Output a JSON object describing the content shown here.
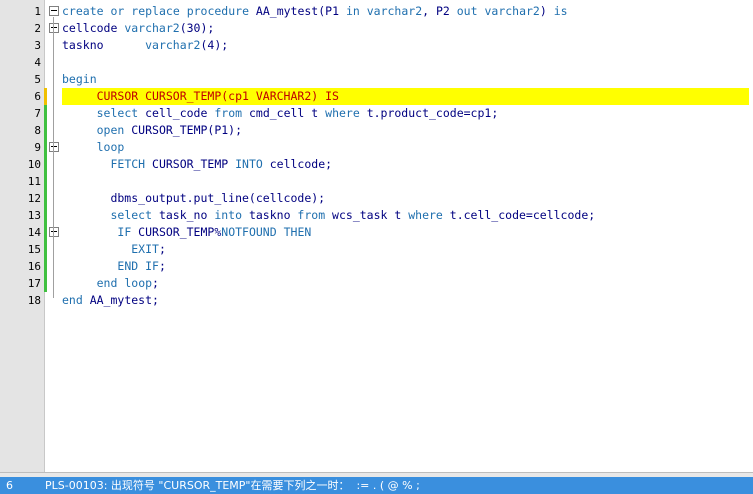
{
  "editor": {
    "lines": [
      {
        "n": "1",
        "tokens": [
          [
            "kw",
            "create"
          ],
          [
            "txt",
            " "
          ],
          [
            "kw",
            "or"
          ],
          [
            "txt",
            " "
          ],
          [
            "kw",
            "replace"
          ],
          [
            "txt",
            " "
          ],
          [
            "kw",
            "procedure"
          ],
          [
            "txt",
            " AA_mytest(P1 "
          ],
          [
            "kw",
            "in"
          ],
          [
            "txt",
            " "
          ],
          [
            "kw",
            "varchar2"
          ],
          [
            "txt",
            ", P2 "
          ],
          [
            "kw",
            "out"
          ],
          [
            "txt",
            " "
          ],
          [
            "kw",
            "varchar2"
          ],
          [
            "txt",
            ") "
          ],
          [
            "kw",
            "is"
          ]
        ]
      },
      {
        "n": "2",
        "tokens": [
          [
            "txt",
            "cellcode "
          ],
          [
            "kw",
            "varchar2"
          ],
          [
            "txt",
            "(30);"
          ]
        ]
      },
      {
        "n": "3",
        "tokens": [
          [
            "txt",
            "taskno      "
          ],
          [
            "kw",
            "varchar2"
          ],
          [
            "txt",
            "(4);"
          ]
        ]
      },
      {
        "n": "4",
        "tokens": []
      },
      {
        "n": "5",
        "tokens": [
          [
            "kw",
            "begin"
          ]
        ]
      },
      {
        "n": "6",
        "tokens": [
          [
            "txt",
            "     "
          ],
          [
            "kwr",
            "CURSOR CURSOR_TEMP(cp1 VARCHAR2) IS"
          ]
        ]
      },
      {
        "n": "7",
        "tokens": [
          [
            "txt",
            "     "
          ],
          [
            "kw",
            "select"
          ],
          [
            "txt",
            " cell_code "
          ],
          [
            "kw",
            "from"
          ],
          [
            "txt",
            " cmd_cell t "
          ],
          [
            "kw",
            "where"
          ],
          [
            "txt",
            " t.product_code=cp1;"
          ]
        ]
      },
      {
        "n": "8",
        "tokens": [
          [
            "txt",
            "     "
          ],
          [
            "kw",
            "open"
          ],
          [
            "txt",
            " CURSOR_TEMP(P1);"
          ]
        ]
      },
      {
        "n": "9",
        "tokens": [
          [
            "txt",
            "     "
          ],
          [
            "kw",
            "loop"
          ]
        ]
      },
      {
        "n": "10",
        "tokens": [
          [
            "txt",
            "       "
          ],
          [
            "kw",
            "FETCH"
          ],
          [
            "txt",
            " CURSOR_TEMP "
          ],
          [
            "kw",
            "INTO"
          ],
          [
            "txt",
            " cellcode;"
          ]
        ]
      },
      {
        "n": "11",
        "tokens": []
      },
      {
        "n": "12",
        "tokens": [
          [
            "txt",
            "       dbms_output.put_line(cellcode);"
          ]
        ]
      },
      {
        "n": "13",
        "tokens": [
          [
            "txt",
            "       "
          ],
          [
            "kw",
            "select"
          ],
          [
            "txt",
            " task_no "
          ],
          [
            "kw",
            "into"
          ],
          [
            "txt",
            " taskno "
          ],
          [
            "kw",
            "from"
          ],
          [
            "txt",
            " wcs_task t "
          ],
          [
            "kw",
            "where"
          ],
          [
            "txt",
            " t.cell_code=cellcode;"
          ]
        ]
      },
      {
        "n": "14",
        "tokens": [
          [
            "txt",
            "        "
          ],
          [
            "kw",
            "IF"
          ],
          [
            "txt",
            " CURSOR_TEMP%"
          ],
          [
            "kw",
            "NOTFOUND"
          ],
          [
            "txt",
            " "
          ],
          [
            "kw",
            "THEN"
          ]
        ]
      },
      {
        "n": "15",
        "tokens": [
          [
            "txt",
            "          "
          ],
          [
            "kw",
            "EXIT"
          ],
          [
            "txt",
            ";"
          ]
        ]
      },
      {
        "n": "16",
        "tokens": [
          [
            "txt",
            "        "
          ],
          [
            "kw",
            "END"
          ],
          [
            "txt",
            " "
          ],
          [
            "kw",
            "IF"
          ],
          [
            "txt",
            ";"
          ]
        ]
      },
      {
        "n": "17",
        "tokens": [
          [
            "txt",
            "     "
          ],
          [
            "kw",
            "end"
          ],
          [
            "txt",
            " "
          ],
          [
            "kw",
            "loop"
          ],
          [
            "txt",
            ";"
          ]
        ]
      },
      {
        "n": "18",
        "tokens": [
          [
            "kw",
            "end"
          ],
          [
            "txt",
            " AA_mytest;"
          ]
        ]
      }
    ]
  },
  "status": {
    "line": "6",
    "message": "PLS-00103: 出现符号 \"CURSOR_TEMP\"在需要下列之一时：  := . ( @ % ;"
  },
  "colors": {
    "keyword": "#1f6fae",
    "error_keyword": "#c00000",
    "identifier": "#000080",
    "highlight": "#ffff00",
    "status_bar": "#3a8fde",
    "change_marker": "#40c040"
  }
}
